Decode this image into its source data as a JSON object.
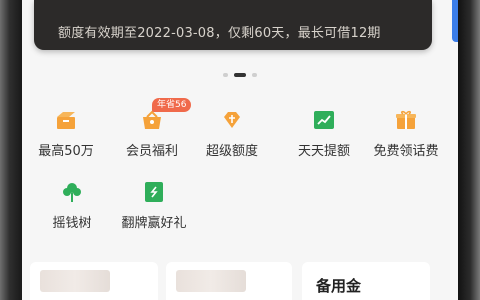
{
  "toast": {
    "message": "额度有效期至2022-03-08，仅剩60天，最长可借12期"
  },
  "carousel": {
    "active_index": 1,
    "count": 3
  },
  "services": [
    {
      "label": "最高50万",
      "icon": "box-open-icon"
    },
    {
      "label": "会员福利",
      "icon": "gift-basket-icon",
      "badge": "年省56"
    },
    {
      "label": "超级额度",
      "icon": "diamond-icon"
    },
    {
      "label": "天天提额",
      "icon": "trend-up-icon"
    },
    {
      "label": "免费领话费",
      "icon": "gift-box-icon"
    },
    {
      "label": "摇钱树",
      "icon": "tree-icon"
    },
    {
      "label": "翻牌赢好礼",
      "icon": "card-flip-icon"
    }
  ],
  "cards": [
    {
      "title": ""
    },
    {
      "title": ""
    },
    {
      "title": "备用金"
    }
  ],
  "colors": {
    "accent_orange": "#f5a23a",
    "accent_green": "#2fae5a",
    "badge_red": "#f06a4b",
    "toast_bg": "#2c2a29"
  }
}
